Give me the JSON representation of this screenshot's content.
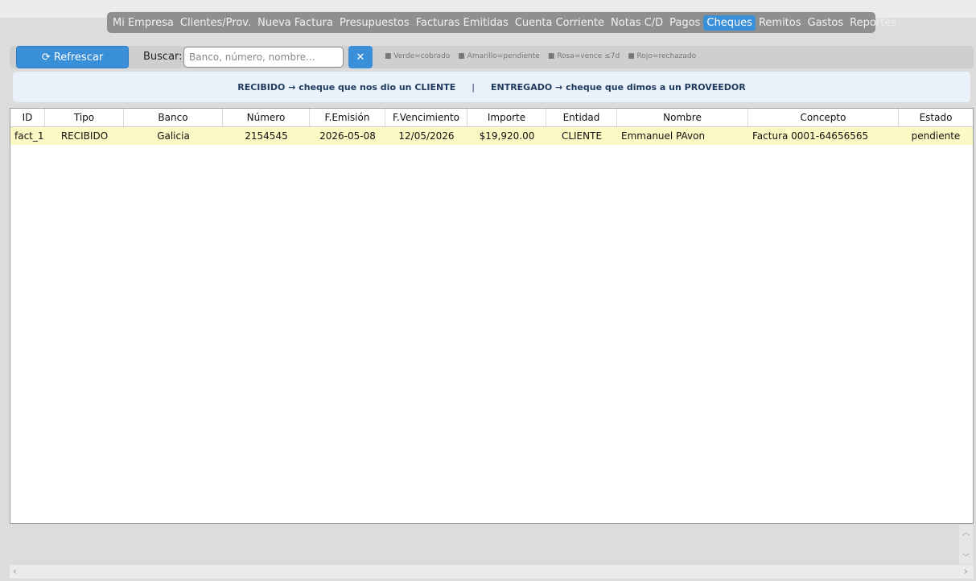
{
  "tabs": [
    "Mi Empresa",
    "Clientes/Prov.",
    "Nueva Factura",
    "Presupuestos",
    "Facturas Emitidas",
    "Cuenta Corriente",
    "Notas C/D",
    "Pagos",
    "Cheques",
    "Remitos",
    "Gastos",
    "Reportes"
  ],
  "active_tab": "Cheques",
  "toolbar": {
    "refresh_label": "⟳ Refrescar",
    "search_label": "Buscar:",
    "search_placeholder": "Banco, número, nombre...",
    "search_value": "",
    "clear_label": "✕",
    "legend": [
      "■ Verde=cobrado",
      "■ Amarillo=pendiente",
      "■ Rosa=vence ≤7d",
      "■ Rojo=rechazado"
    ]
  },
  "info": {
    "received": "RECIBIDO  →  cheque que nos dio un CLIENTE",
    "separator": "|",
    "delivered": "ENTREGADO  →  cheque que dimos a un PROVEEDOR"
  },
  "table": {
    "columns": [
      "ID",
      "Tipo",
      "Banco",
      "Número",
      "F.Emisión",
      "F.Vencimiento",
      "Importe",
      "Entidad",
      "Nombre",
      "Concepto",
      "Estado"
    ],
    "rows": [
      [
        "fact_1",
        "RECIBIDO",
        "Galicia",
        "2154545",
        "2026-05-08",
        "12/05/2026",
        "$19,920.00",
        "CLIENTE",
        "Emmanuel PAvon",
        "Factura 0001-64656565",
        "pendiente"
      ]
    ]
  },
  "colors": {
    "accent": "#3a8fd9",
    "pending_row": "#fdf9c4"
  }
}
